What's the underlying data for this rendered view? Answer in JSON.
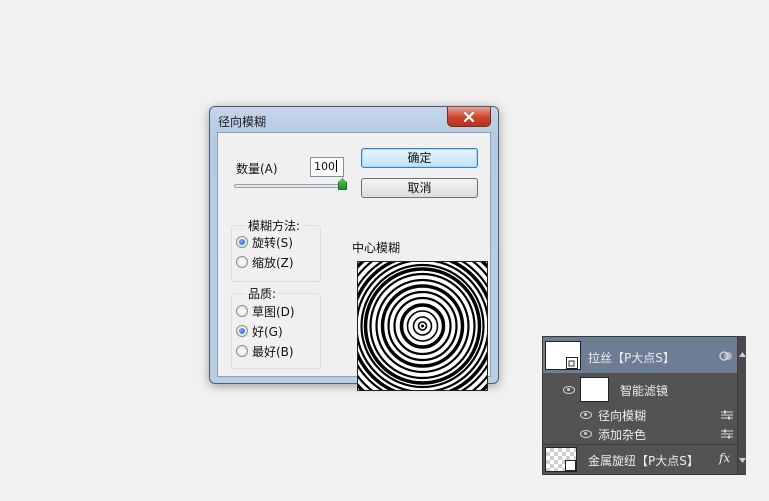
{
  "dialog": {
    "title": "径向模糊",
    "amount_label": "数量(A)",
    "amount_value": "100",
    "amount_fraction": 1.0,
    "ok_label": "确定",
    "cancel_label": "取消",
    "method": {
      "legend": "模糊方法:",
      "options": [
        {
          "label": "旋转(S)",
          "selected": true
        },
        {
          "label": "缩放(Z)",
          "selected": false
        }
      ]
    },
    "quality": {
      "legend": "品质:",
      "options": [
        {
          "label": "草图(D)",
          "selected": false
        },
        {
          "label": "好(G)",
          "selected": true
        },
        {
          "label": "最好(B)",
          "selected": false
        }
      ]
    },
    "center_label": "中心模糊"
  },
  "layers": {
    "items": [
      {
        "name": "拉丝【P大点S】",
        "selected": true
      },
      {
        "name": "智能滤镜"
      },
      {
        "name": "径向模糊"
      },
      {
        "name": "添加杂色"
      },
      {
        "name": "金属旋纽【P大点S】",
        "fx": "fx"
      }
    ]
  },
  "colors": {
    "dialog_frame": "#b9cde3",
    "close_red": "#c9452e",
    "layers_bg": "#535353",
    "layer_selected": "#6d7d93"
  }
}
